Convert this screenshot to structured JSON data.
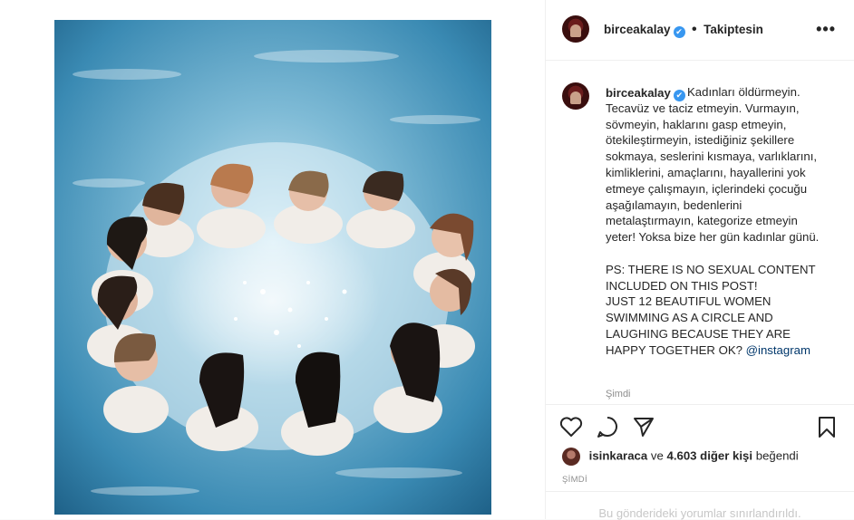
{
  "post": {
    "username": "birceakalay",
    "verified_mark": "✔",
    "separator": "•",
    "follow_state": "Takiptesin",
    "more_icon": "more-dots-icon",
    "caption": "Kadınları öldürmeyin. Tecavüz ve taciz etmeyin. Vurmayın, sövmeyin, haklarını gasp etmeyin, ötekileştirmeyin, istediğiniz şekillere sokmaya, seslerini kısmaya, varlıklarını, kimliklerini, amaçlarını, hayallerini yok etmeye çalışmayın, içlerindeki çocuğu aşağılamayın, bedenlerini metalaştırmayın, kategorize etmeyin yeter! Yoksa bize her gün kadınlar günü.\n\nPS: THERE IS NO SEXUAL CONTENT INCLUDED ON THIS POST!\nJUST 12 BEAUTIFUL WOMEN SWIMMING AS A CIRCLE AND LAUGHING BECAUSE THEY ARE HAPPY TOGETHER OK? ",
    "mention": "@instagram",
    "time_ago": "Şimdi",
    "likes_user": "isinkaraca",
    "likes_joiner": "ve",
    "likes_others": "4.603 diğer kişi",
    "likes_suffix": "beğendi",
    "timestamp": "ŞİMDİ",
    "comments_limited": "Bu gönderideki yorumlar sınırlandırıldı."
  },
  "icons": {
    "like": "heart-icon",
    "comment": "comment-icon",
    "share": "share-icon",
    "save": "bookmark-icon"
  },
  "colors": {
    "verified": "#3897f0",
    "mention": "#00376b",
    "muted": "#8e8e8e",
    "water_light": "#8fc6de",
    "water_dark": "#1f6f9a"
  }
}
